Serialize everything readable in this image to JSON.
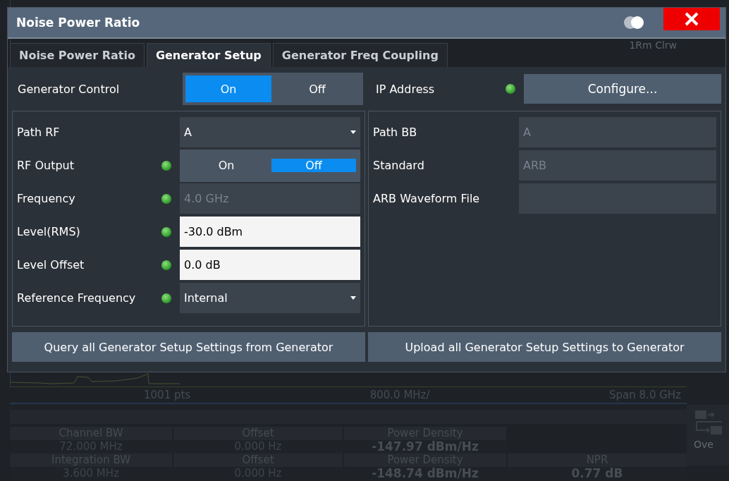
{
  "background": {
    "trace_label": "1Rm Clrw",
    "axis": [
      "1001 pts",
      "800.0 MHz/",
      "Span 8.0 GHz"
    ],
    "table": {
      "rows": [
        {
          "kind": "header",
          "cells": [
            "Channel BW",
            "Offset",
            "Power Density"
          ]
        },
        {
          "kind": "value",
          "cells": [
            "72.000 MHz",
            "0.000 Hz",
            "-147.97 dBm/Hz"
          ]
        },
        {
          "kind": "header",
          "cells": [
            "Integration BW",
            "Offset",
            "Power Density",
            "NPR"
          ]
        },
        {
          "kind": "value",
          "cells": [
            "3.600 MHz",
            "0.000 Hz",
            "-148.74 dBm/Hz",
            "0.77 dB"
          ]
        }
      ]
    },
    "side_key": "Ove"
  },
  "dialog": {
    "title": "Noise Power Ratio",
    "tabs": [
      {
        "label": "Noise Power Ratio",
        "selected": false
      },
      {
        "label": "Generator Setup",
        "selected": true
      },
      {
        "label": "Generator Freq Coupling",
        "selected": false
      }
    ],
    "generator_control": {
      "label": "Generator Control",
      "options": [
        {
          "label": "On",
          "selected": true
        },
        {
          "label": "Off",
          "selected": false
        }
      ]
    },
    "ip_address": {
      "label": "IP Address",
      "led": true,
      "button": "Configure..."
    },
    "left_fields": [
      {
        "label": "Path RF",
        "kind": "dropdown",
        "value": "A"
      },
      {
        "label": "RF Output",
        "led": true,
        "kind": "toggle",
        "options": [
          {
            "label": "On",
            "selected": false
          },
          {
            "label": "Off",
            "selected": true
          }
        ]
      },
      {
        "label": "Frequency",
        "led": true,
        "kind": "readonly",
        "value": "4.0 GHz"
      },
      {
        "label": "Level(RMS)",
        "led": true,
        "kind": "input",
        "value": "-30.0 dBm"
      },
      {
        "label": "Level Offset",
        "led": true,
        "kind": "input",
        "value": "0.0 dB"
      },
      {
        "label": "Reference Frequency",
        "led": true,
        "kind": "dropdown",
        "value": "Internal"
      }
    ],
    "right_fields": [
      {
        "label": "Path BB",
        "kind": "readonly",
        "value": "A"
      },
      {
        "label": "Standard",
        "kind": "readonly",
        "value": "ARB"
      },
      {
        "label": "ARB Waveform File",
        "kind": "readonly"
      }
    ],
    "buttons": [
      "Query all Generator Setup Settings from Generator",
      "Upload all Generator Setup Settings to Generator"
    ]
  }
}
